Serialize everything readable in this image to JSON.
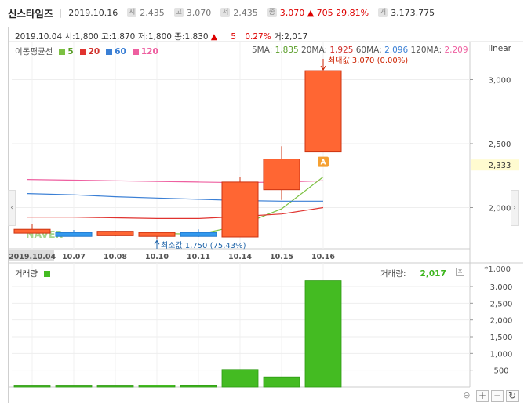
{
  "header": {
    "name": "신스타임즈",
    "date": "2019.10.16",
    "items": [
      {
        "prefix": "시",
        "value": "2,435"
      },
      {
        "prefix": "고",
        "value": "3,070"
      },
      {
        "prefix": "저",
        "value": "2,435"
      },
      {
        "prefix": "종",
        "value": "3,070 ▲ 705 29.81%"
      },
      {
        "prefix": "거",
        "value": "3,173,775"
      }
    ]
  },
  "ohlc": {
    "date": "2019.10.04",
    "open_label": "시:",
    "open": "1,800",
    "high_label": "고:",
    "high": "1,870",
    "low_label": "저:",
    "low": "1,800",
    "close_label": "종:",
    "close": "1,830",
    "change": "▲",
    "change_value": "5",
    "change_pct": "0.27%",
    "volume_label": "거:",
    "volume": "2,017"
  },
  "scale_mode": "linear",
  "ma_legend": {
    "title": "이동평균선",
    "items": [
      {
        "period": "5",
        "color": "#7cc142"
      },
      {
        "period": "20",
        "color": "#e0332f"
      },
      {
        "period": "60",
        "color": "#3a7fd5"
      },
      {
        "period": "120",
        "color": "#ee5fa0"
      }
    ]
  },
  "ma_values": [
    {
      "label": "5MA:",
      "value": "1,835",
      "color": "#5b9e2a"
    },
    {
      "label": "20MA:",
      "value": "1,925",
      "color": "#d0302b"
    },
    {
      "label": "60MA:",
      "value": "2,096",
      "color": "#3a7fd5"
    },
    {
      "label": "120MA:",
      "value": "2,209",
      "color": "#ee5fa0"
    }
  ],
  "annotations": {
    "max": "최대값 3,070 (0.00%)",
    "min": "최소값 1,750 (75.43%)",
    "current_price": "2,333",
    "marker": "A",
    "watermark": "NAVER"
  },
  "volume_panel": {
    "title": "거래량",
    "value_label": "거래량:",
    "value": "2,017",
    "unit": "*1,000",
    "close_x": "x"
  },
  "colors": {
    "up": "#ff6633",
    "down": "#3399ee",
    "volume": "#44bb22",
    "label_bg": "#fffbd0"
  },
  "chart_data": [
    {
      "type": "candlestick",
      "categories": [
        "2019.10.04",
        "10.07",
        "10.08",
        "10.10",
        "10.11",
        "10.14",
        "10.15",
        "10.16"
      ],
      "ohlc": [
        {
          "open": 1800,
          "high": 1870,
          "low": 1800,
          "close": 1830
        },
        {
          "open": 1800,
          "high": 1825,
          "low": 1780,
          "close": 1780
        },
        {
          "open": 1780,
          "high": 1820,
          "low": 1775,
          "close": 1815
        },
        {
          "open": 1790,
          "high": 1805,
          "low": 1750,
          "close": 1790
        },
        {
          "open": 1800,
          "high": 1830,
          "low": 1770,
          "close": 1780
        },
        {
          "open": 1770,
          "high": 2240,
          "low": 1770,
          "close": 2200
        },
        {
          "open": 2140,
          "high": 2480,
          "low": 2060,
          "close": 2380
        },
        {
          "open": 2435,
          "high": 3070,
          "low": 2435,
          "close": 3070
        }
      ],
      "ma_series": [
        {
          "name": "5",
          "x": [
            "10.10",
            "10.11",
            "10.14",
            "10.15",
            "10.16"
          ],
          "values": [
            1800,
            1790,
            1860,
            1990,
            2240
          ]
        },
        {
          "name": "20",
          "x": [
            "2019.10.04",
            "10.07",
            "10.08",
            "10.10",
            "10.11",
            "10.14",
            "10.15",
            "10.16"
          ],
          "values": [
            1925,
            1925,
            1920,
            1915,
            1915,
            1930,
            1950,
            2000
          ]
        },
        {
          "name": "60",
          "x": [
            "2019.10.04",
            "10.07",
            "10.08",
            "10.10",
            "10.11",
            "10.14",
            "10.15",
            "10.16"
          ],
          "values": [
            2110,
            2100,
            2085,
            2075,
            2065,
            2055,
            2050,
            2050
          ]
        },
        {
          "name": "120",
          "x": [
            "2019.10.04",
            "10.07",
            "10.08",
            "10.10",
            "10.11",
            "10.14",
            "10.15",
            "10.16"
          ],
          "values": [
            2220,
            2215,
            2210,
            2205,
            2200,
            2195,
            2200,
            2210
          ]
        }
      ],
      "yticks": [
        2000,
        2500,
        3000
      ],
      "ytick_labels": [
        "2,000",
        "2,500",
        "3,000"
      ],
      "ylim": [
        1700,
        3200
      ],
      "grid": true
    },
    {
      "type": "bar",
      "title": "거래량",
      "categories": [
        "2019.10.04",
        "10.07",
        "10.08",
        "10.10",
        "10.11",
        "10.14",
        "10.15",
        "10.16"
      ],
      "values": [
        20,
        30,
        25,
        60,
        40,
        520,
        300,
        3174
      ],
      "yticks": [
        500,
        1000,
        1500,
        2000,
        2500,
        3000
      ],
      "ytick_labels": [
        "500",
        "1,000",
        "1,500",
        "2,000",
        "2,500",
        "3,000"
      ],
      "ylim": [
        0,
        3260
      ],
      "grid": true
    }
  ]
}
